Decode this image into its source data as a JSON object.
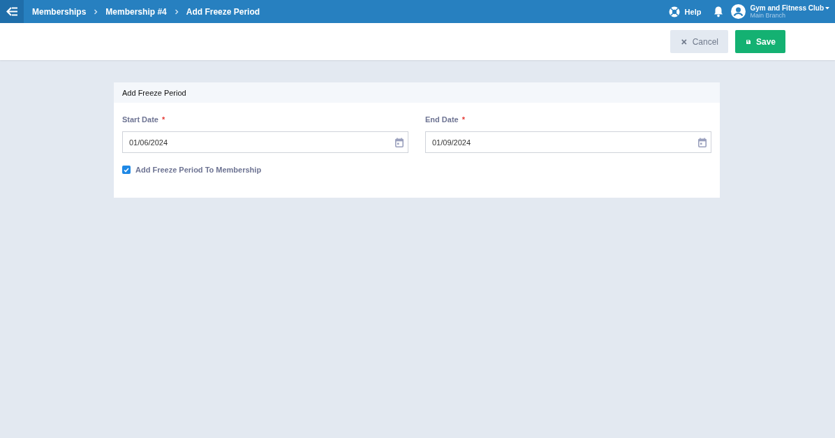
{
  "breadcrumbs": [
    {
      "label": "Memberships"
    },
    {
      "label": "Membership #4"
    },
    {
      "label": "Add Freeze Period"
    }
  ],
  "header": {
    "help": "Help",
    "account": {
      "name": "Gym and Fitness Club",
      "branch": "Main Branch"
    }
  },
  "actions": [
    {
      "kind": "cancel",
      "label": "Cancel"
    },
    {
      "kind": "save",
      "label": "Save"
    }
  ],
  "form": {
    "title": "Add Freeze Period",
    "fields": [
      {
        "label": "Start Date",
        "required_mark": "*",
        "value": "01/06/2024"
      },
      {
        "label": "End Date",
        "required_mark": "*",
        "value": "01/09/2024"
      }
    ],
    "checkbox": {
      "label": "Add Freeze Period To Membership",
      "checked": true
    }
  }
}
